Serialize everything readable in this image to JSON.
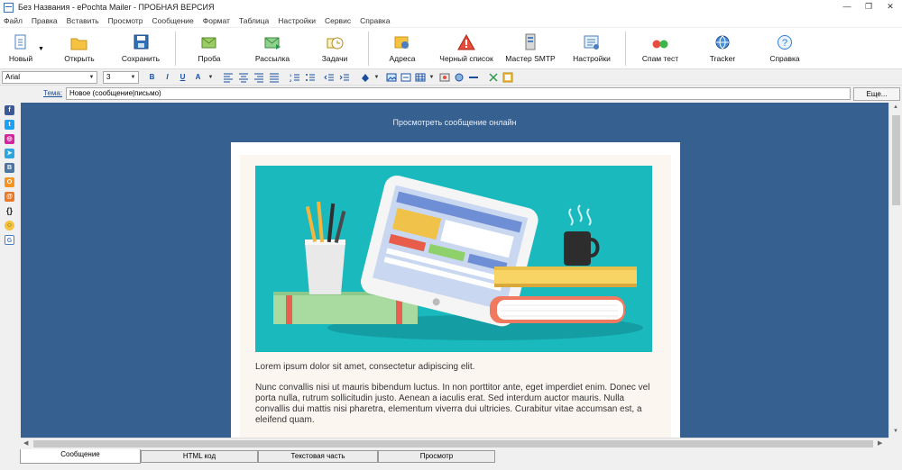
{
  "window": {
    "title": "Без Названия - ePochta Mailer - ПРОБНАЯ ВЕРСИЯ",
    "minimize": "—",
    "restore": "❐",
    "close": "✕"
  },
  "menu": {
    "items": [
      "Файл",
      "Правка",
      "Вставить",
      "Просмотр",
      "Сообщение",
      "Формат",
      "Таблица",
      "Настройки",
      "Сервис",
      "Справка"
    ]
  },
  "toolbar": {
    "new": "Новый",
    "open": "Открыть",
    "save": "Сохранить",
    "test": "Проба",
    "send": "Рассылка",
    "tasks": "Задачи",
    "addresses": "Адреса",
    "blacklist": "Черный список",
    "smtp_wizard": "Мастер SMTP",
    "settings": "Настройки",
    "spam_test": "Спам тест",
    "tracker": "Tracker",
    "help": "Справка"
  },
  "format": {
    "font": "Arial",
    "size": "3",
    "bold": "B",
    "italic": "I",
    "underline": "U",
    "font_color": "A"
  },
  "subject": {
    "label": "Тема:",
    "value": "Новое (сообщение|письмо)",
    "more": "Еще..."
  },
  "editor": {
    "online_link": "Просмотреть сообщение онлайн",
    "paragraph1": "Lorem ipsum dolor sit amet, consectetur adipiscing elit.",
    "paragraph2": "Nunc convallis nisi ut mauris bibendum luctus. In non porttitor ante, eget imperdiet enim. Donec vel porta nulla, rutrum sollicitudin justo. Aenean a iaculis erat. Sed interdum auctor mauris. Nulla convallis dui mattis nisi pharetra, elementum viverra dui ultricies. Curabitur vitae accumsan est, a eleifend quam.",
    "background_color": "#36608f",
    "hero_color": "#1ab9be"
  },
  "tabs": {
    "message": "Сообщение",
    "html_code": "HTML код",
    "text_part": "Текстовая часть",
    "preview": "Просмотр"
  }
}
